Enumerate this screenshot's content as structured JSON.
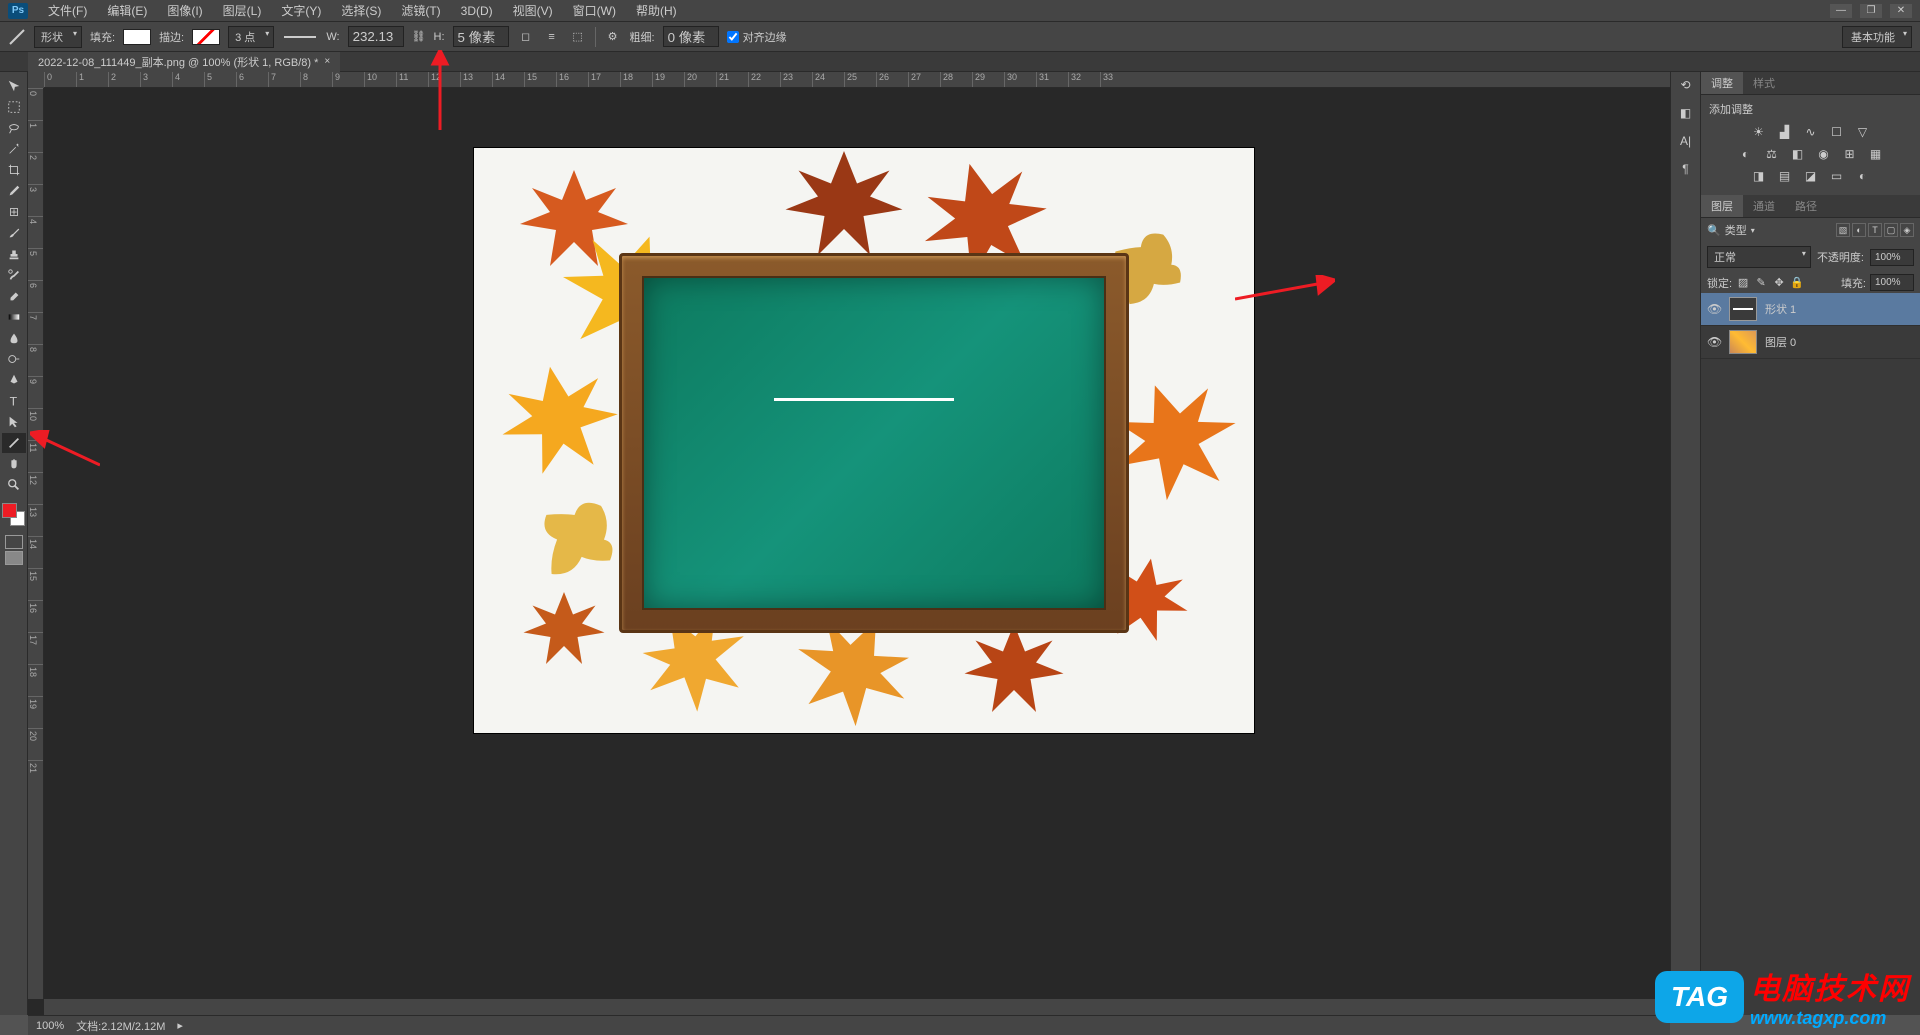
{
  "app": {
    "logo": "Ps"
  },
  "menu": {
    "items": [
      "文件(F)",
      "编辑(E)",
      "图像(I)",
      "图层(L)",
      "文字(Y)",
      "选择(S)",
      "滤镜(T)",
      "3D(D)",
      "视图(V)",
      "窗口(W)",
      "帮助(H)"
    ]
  },
  "options": {
    "mode": "形状",
    "fill_label": "填充:",
    "stroke_label": "描边:",
    "stroke_width": "3 点",
    "w_label": "W:",
    "w_value": "232.13",
    "h_label": "H:",
    "h_value": "5 像素",
    "weight_label": "粗细:",
    "weight_value": "0 像素",
    "align_edges": "对齐边缘",
    "basic_func": "基本功能"
  },
  "tab": {
    "title": "2022-12-08_111449_副本.png @ 100% (形状 1, RGB/8) *"
  },
  "ruler_h": [
    "0",
    "1",
    "2",
    "3",
    "4",
    "5",
    "6",
    "7",
    "8",
    "9",
    "10",
    "11",
    "12",
    "13",
    "14",
    "15",
    "16",
    "17",
    "18",
    "19",
    "20",
    "21",
    "22",
    "23",
    "24",
    "25",
    "26",
    "27",
    "28",
    "29",
    "30",
    "31",
    "32",
    "33"
  ],
  "ruler_v": [
    "0",
    "1",
    "2",
    "3",
    "4",
    "5",
    "6",
    "7",
    "8",
    "9",
    "10",
    "11",
    "12",
    "13",
    "14",
    "15",
    "16",
    "17",
    "18",
    "19",
    "20",
    "21"
  ],
  "panels": {
    "adj_tab1": "调整",
    "adj_tab2": "样式",
    "adj_title": "添加调整",
    "layers_tab1": "图层",
    "layers_tab2": "通道",
    "layers_tab3": "路径",
    "kind_label": "类型",
    "blend_mode": "正常",
    "opacity_label": "不透明度:",
    "opacity_value": "100%",
    "lock_label": "锁定:",
    "fill_label": "填充:",
    "fill_value": "100%",
    "layer1_name": "形状 1",
    "layer2_name": "图层 0"
  },
  "status": {
    "zoom": "100%",
    "doc_info": "文档:2.12M/2.12M"
  },
  "watermark": {
    "tag": "TAG",
    "cn": "电脑技术网",
    "url": "www.tagxp.com"
  }
}
